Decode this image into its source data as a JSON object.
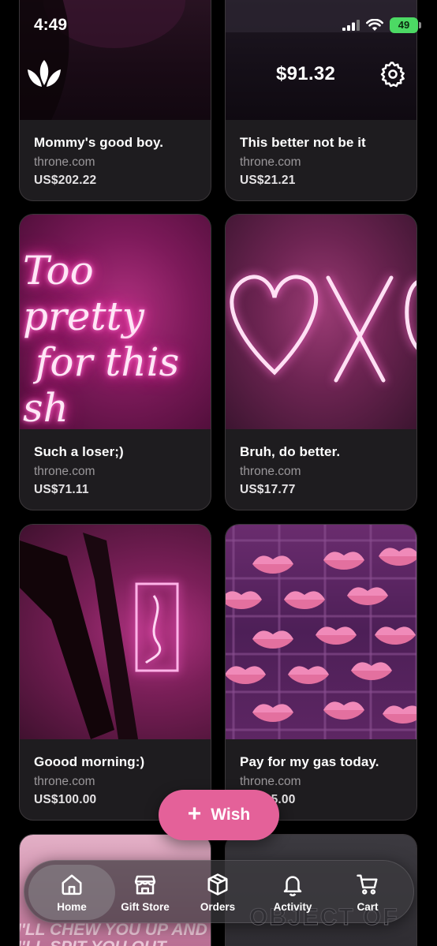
{
  "status_bar": {
    "time": "4:49",
    "battery": "49"
  },
  "header": {
    "balance": "$91.32",
    "logo_icon": "throne-crown-logo-icon",
    "settings_icon": "gear-icon"
  },
  "wishlist": [
    {
      "title": "Mommy's good boy.",
      "site": "throne.com",
      "price": "US$202.22"
    },
    {
      "title": "This better not be it",
      "site": "throne.com",
      "price": "US$21.21"
    },
    {
      "title": "Such a loser;)",
      "site": "throne.com",
      "price": "US$71.11",
      "image_text": "Too pretty for this sh"
    },
    {
      "title": "Bruh, do better.",
      "site": "throne.com",
      "price": "US$17.77"
    },
    {
      "title": "Goood morning:)",
      "site": "throne.com",
      "price": "US$100.00"
    },
    {
      "title": "Pay for my gas today.",
      "site": "throne.com",
      "price": "US$65.00"
    },
    {
      "image_text": "I'LL CHEW YOU UP AND I'LL SPIT YOU OUT"
    },
    {
      "image_text": "OBJECT OF"
    }
  ],
  "wish_button": {
    "label": "Wish",
    "color": "#e46199"
  },
  "bottom_nav": [
    {
      "label": "Home",
      "icon": "home-icon",
      "active": true
    },
    {
      "label": "Gift Store",
      "icon": "store-icon",
      "active": false
    },
    {
      "label": "Orders",
      "icon": "box-icon",
      "active": false
    },
    {
      "label": "Activity",
      "icon": "bell-icon",
      "active": false
    },
    {
      "label": "Cart",
      "icon": "cart-icon",
      "active": false
    }
  ],
  "colors": {
    "background": "#000000",
    "card": "#1e1c1f",
    "accent": "#e46199",
    "battery": "#4cd964"
  }
}
